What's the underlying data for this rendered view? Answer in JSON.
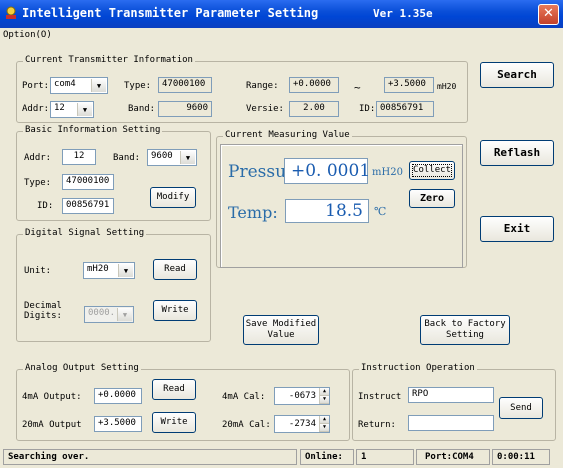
{
  "window": {
    "title": "Intelligent Transmitter Parameter Setting",
    "version": "Ver 1.35e",
    "close_label": "✕"
  },
  "menu": {
    "option": "Option(O)"
  },
  "current_info": {
    "group_label": "Current Transmitter Information",
    "port_label": "Port:",
    "port_value": "com4",
    "type_label": "Type:",
    "type_value": "47000100",
    "range_label": "Range:",
    "range_min": "+0.0000",
    "range_sep": "~",
    "range_max": "+3.5000",
    "range_unit": "mH20",
    "addr_label": "Addr:",
    "addr_value": "12",
    "band_label": "Band:",
    "band_value": "9600",
    "versie_label": "Versie:",
    "versie_value": "2.00",
    "id_label": "ID:",
    "id_value": "00856791"
  },
  "basic": {
    "group_label": "Basic Information Setting",
    "addr_label": "Addr:",
    "addr_value": "12",
    "band_label": "Band:",
    "band_value": "9600",
    "type_label": "Type:",
    "type_value": "47000100",
    "id_label": "ID:",
    "id_value": "00856791",
    "modify_label": "Modify"
  },
  "measure": {
    "group_label": "Current Measuring Value",
    "pressure_label": "Pressu",
    "pressure_value": "+0. 0001",
    "pressure_unit": "mH20",
    "collect_label": "Collect",
    "zero_label": "Zero",
    "temp_label": "Temp:",
    "temp_value": "18.5",
    "temp_unit": "℃"
  },
  "digital": {
    "group_label": "Digital Signal Setting",
    "unit_label": "Unit:",
    "unit_value": "mH20",
    "read_label": "Read",
    "decimal_label": "Decimal\nDigits:",
    "decimal_value": "0000.",
    "write_label": "Write"
  },
  "actions": {
    "save_label": "Save Modified\nValue",
    "factory_label": "Back to Factory\nSetting",
    "search_label": "Search",
    "reflash_label": "Reflash",
    "exit_label": "Exit"
  },
  "analog": {
    "group_label": "Analog Output Setting",
    "out4_label": "4mA Output:",
    "out4_value": "+0.0000",
    "read_label": "Read",
    "cal4_label": "4mA Cal:",
    "cal4_value": "-0673",
    "out20_label": "20mA Output",
    "out20_value": "+3.5000",
    "write_label": "Write",
    "cal20_label": "20mA Cal:",
    "cal20_value": "-2734"
  },
  "instruction": {
    "group_label": "Instruction Operation",
    "instruct_label": "Instruct",
    "instruct_value": "RPO",
    "return_label": "Return:",
    "return_value": "",
    "send_label": "Send"
  },
  "status": {
    "message": "Searching over.",
    "online_label": "Online:",
    "online_value": "1",
    "port": "Port:COM4",
    "time": "0:00:11"
  },
  "colors": {
    "title_bar": "#0046d5",
    "value_text": "#2a6ca8",
    "window_bg": "#ece9d8"
  }
}
